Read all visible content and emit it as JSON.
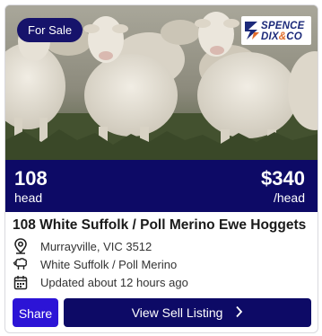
{
  "badge": {
    "label": "For Sale"
  },
  "logo": {
    "line1": "SPENCE",
    "line2a": "DIX",
    "line2b": "&",
    "line2c": "CO"
  },
  "quantity": {
    "value": "108",
    "unit": "head"
  },
  "price": {
    "value": "$340",
    "unit": "/head"
  },
  "listing": {
    "title": "108 White Suffolk / Poll Merino Ewe Hoggets",
    "location": "Murrayville, VIC 3512",
    "breed": "White Suffolk / Poll Merino",
    "updated": "Updated about 12 hours ago"
  },
  "actions": {
    "share_label": "Share",
    "view_label": "View Sell Listing"
  },
  "icons": {
    "location": "map-pin-icon",
    "breed": "sheep-icon",
    "updated": "calendar-icon",
    "view": "chevron-right-icon"
  },
  "colors": {
    "navy": "#0d0a66",
    "share_blue": "#2c14d6",
    "logo_orange": "#e06b2a"
  }
}
